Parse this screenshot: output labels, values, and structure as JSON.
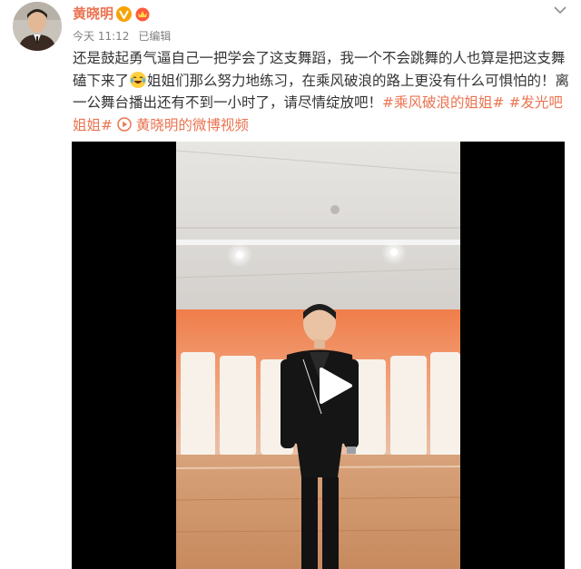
{
  "user": {
    "name": "黄晓明",
    "verified_badge": "V",
    "badges": [
      "verified-v-icon",
      "vip-crown-icon"
    ],
    "accent_color": "#eb7350"
  },
  "post_meta": {
    "time": "今天 11:12",
    "edited": "已编辑"
  },
  "post": {
    "text_part1": "还是鼓起勇气逼自己一把学会了这支舞蹈，我一个不会跳舞的人也算是把这支舞磕下来了",
    "emoji": "laughing-tears-emoji",
    "text_part2": "姐姐们那么努力地练习，在乘风破浪的路上更没有什么可惧怕的！离一公舞台播出还有不到一小时了，请尽情绽放吧！",
    "hashtag1": "#乘风破浪的姐姐#",
    "hashtag2": "#发光吧姐姐#",
    "video_link_icon": "video-play-icon",
    "video_link_label": "黄晓明的微博视频"
  },
  "video": {
    "control": "play-icon",
    "background": "#000000"
  }
}
